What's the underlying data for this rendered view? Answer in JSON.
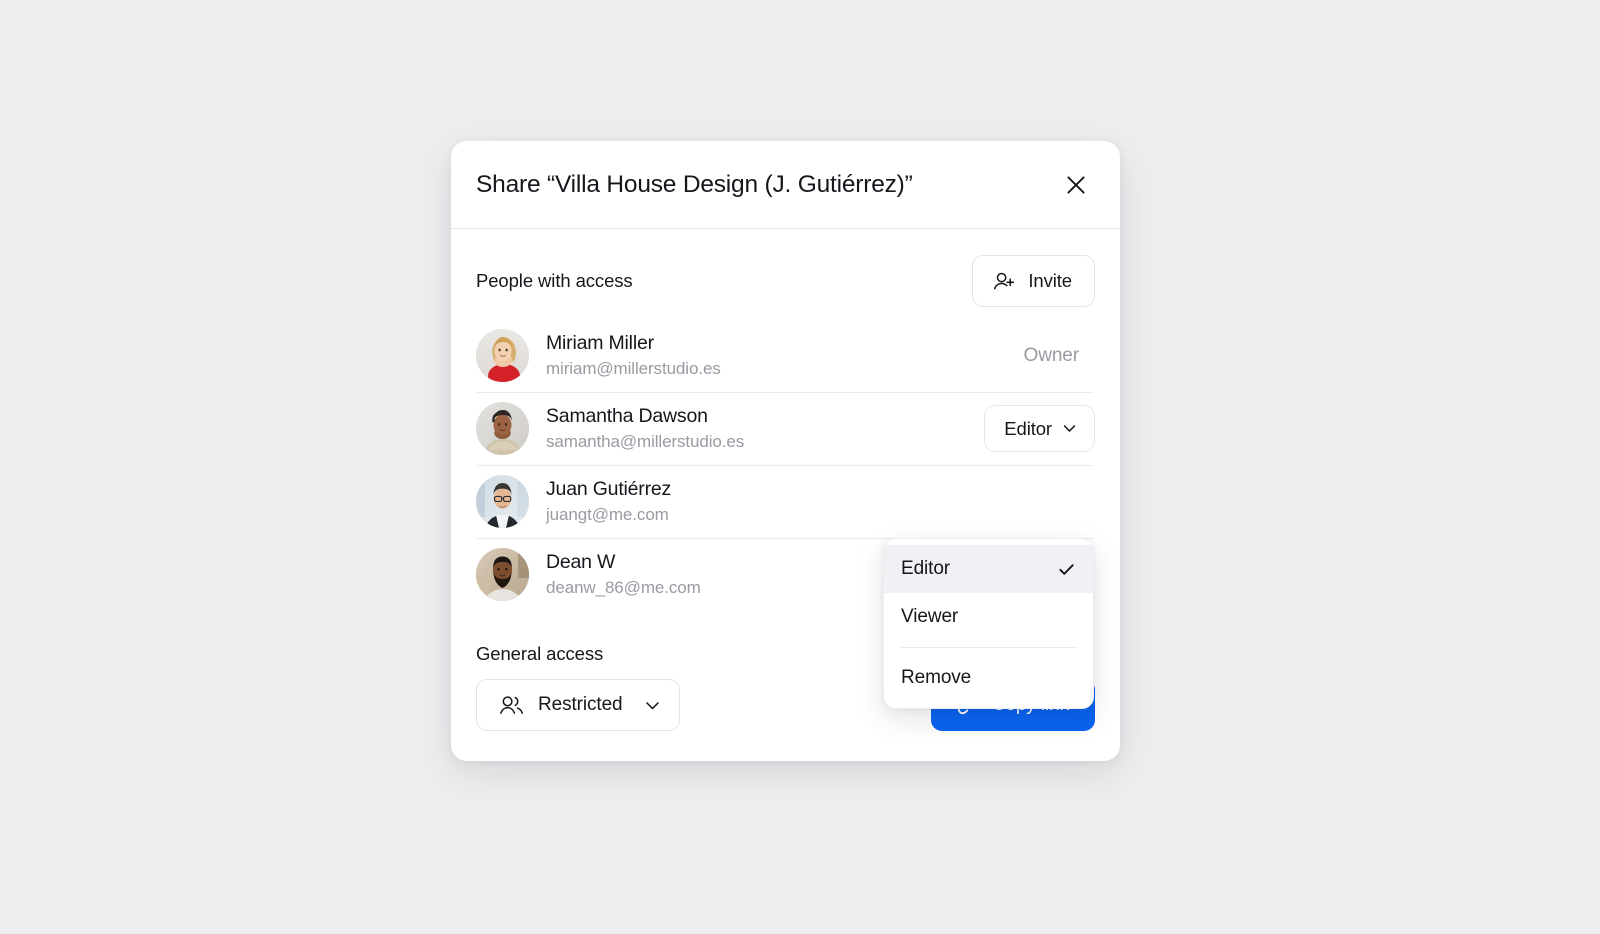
{
  "dialog": {
    "title": "Share “Villa House Design (J. Gutiérrez)”",
    "close_icon": "close-icon"
  },
  "people_section": {
    "label": "People with access",
    "invite_label": "Invite",
    "invite_icon": "person-plus-icon",
    "people": [
      {
        "name": "Miriam Miller",
        "email": "miriam@millerstudio.es",
        "role": "Owner",
        "role_type": "static",
        "avatar": "avatar-miriam"
      },
      {
        "name": "Samantha Dawson",
        "email": "samantha@millerstudio.es",
        "role": "Editor",
        "role_type": "dropdown",
        "avatar": "avatar-samantha"
      },
      {
        "name": "Juan Gutiérrez",
        "email": "juangt@me.com",
        "role": "",
        "role_type": "hidden",
        "avatar": "avatar-juan"
      },
      {
        "name": "Dean W",
        "email": "deanw_86@me.com",
        "role": "",
        "role_type": "hidden",
        "avatar": "avatar-dean"
      }
    ]
  },
  "role_menu": {
    "open": true,
    "items": [
      {
        "label": "Editor",
        "selected": true
      },
      {
        "label": "Viewer",
        "selected": false
      },
      {
        "label": "Remove",
        "selected": false
      }
    ],
    "check_icon": "check-icon"
  },
  "general_access": {
    "label": "General access",
    "selected": "Restricted",
    "people_icon": "people-group-icon",
    "chevron_icon": "chevron-down-icon",
    "copy_link_label": "Copy link",
    "copy_link_icon": "link-icon"
  },
  "colors": {
    "accent": "#0a64f0",
    "page_background": "#eeeef0",
    "dialog_background": "#ffffff",
    "text_primary": "#15171c",
    "text_muted": "#9a9aa2",
    "divider": "#ececed",
    "menu_selected_background": "#f1f1f5"
  }
}
